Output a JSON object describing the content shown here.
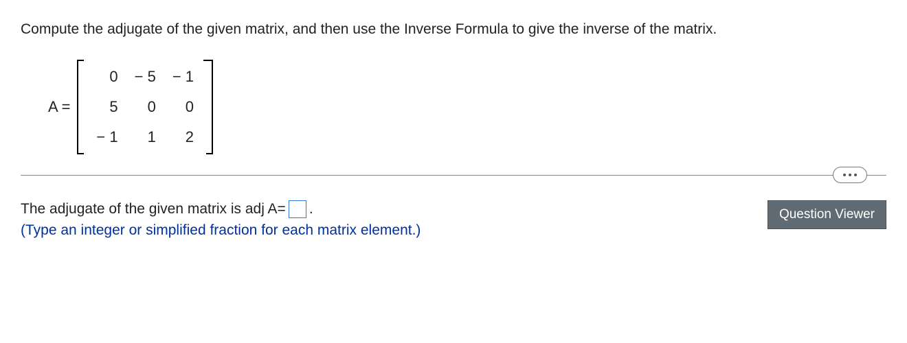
{
  "question": {
    "prompt": "Compute the adjugate of the given matrix, and then use the Inverse Formula to give the inverse of the matrix.",
    "matrix_label": "A =",
    "matrix": {
      "rows": 3,
      "cols": 3,
      "cells": [
        "0",
        "− 5",
        "− 1",
        "5",
        "0",
        "0",
        "− 1",
        "1",
        "2"
      ]
    }
  },
  "answer": {
    "lead_text": "The adjugate of the given matrix is adj A=",
    "trail_text": ".",
    "hint": "(Type an integer or simplified fraction for each matrix element.)"
  },
  "buttons": {
    "question_viewer": "Question Viewer"
  }
}
